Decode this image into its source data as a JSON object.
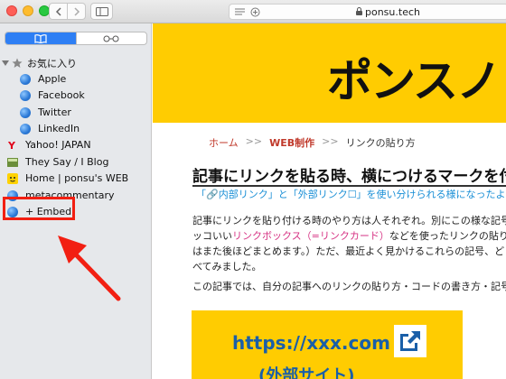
{
  "window": {
    "address": "ponsu.tech"
  },
  "sidebar": {
    "folder_label": "お気に入り",
    "items": [
      {
        "label": "Apple",
        "icon": "globe-icon"
      },
      {
        "label": "Facebook",
        "icon": "globe-icon"
      },
      {
        "label": "Twitter",
        "icon": "globe-icon"
      },
      {
        "label": "LinkedIn",
        "icon": "globe-icon"
      }
    ],
    "top_items": [
      {
        "label": "Yahoo! JAPAN",
        "icon": "yahoo-icon"
      },
      {
        "label": "They Say / I Blog",
        "icon": "site-icon"
      },
      {
        "label": "Home | ponsu's WEB",
        "icon": "smiley-icon"
      },
      {
        "label": "metacommentary",
        "icon": "globe-icon"
      },
      {
        "label": "+ Embed",
        "icon": "globe-icon"
      }
    ]
  },
  "page": {
    "banner_logo": "ポンスノ",
    "breadcrumb": {
      "home": "ホーム",
      "sep1": ">>",
      "category": "WEB制作",
      "sep2": ">>",
      "current": "リンクの貼り方"
    },
    "title": "記事にリンクを貼る時、横につけるマークを付",
    "subtitle": "「🔗内部リンク」と「外部リンク☐」を使い分けられる様になったよと",
    "para1_line1": "記事にリンクを貼り付ける時のやり方は人それぞれ。別にこの様な記号",
    "para1_line2_a": "ッコいい",
    "para1_line2_pink": "リンクボックス（=リンクカード）",
    "para1_line2_b": "などを使ったリンクの貼り",
    "para1_line3": "はまた後ほどまとめます。）ただ、最近よく見かけるこれらの記号、ど",
    "para1_line4": "べてみました。",
    "para2": "この記事では、自分の記事へのリンクの貼り方・コードの書き方・記号の",
    "card_url": "https://xxx.com",
    "card_sub": "(外部サイト)"
  },
  "colors": {
    "banner": "#ffcc01",
    "highlight": "#f21f12",
    "link_blue": "#1a8fd6",
    "accent": "#2e7ff4"
  }
}
